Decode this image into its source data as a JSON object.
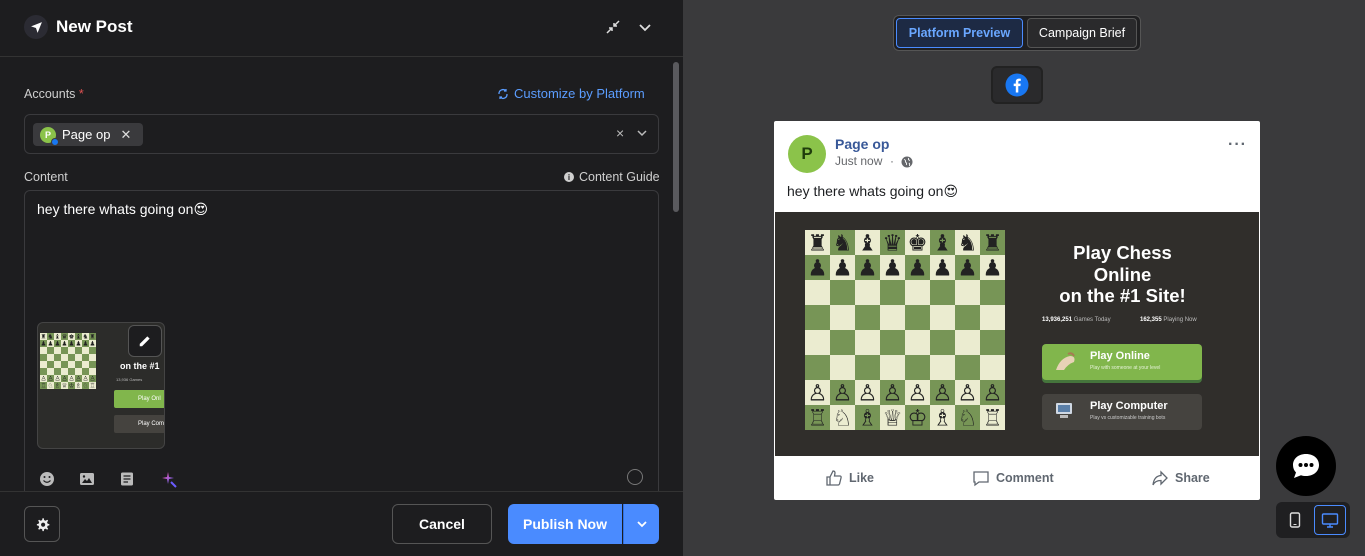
{
  "editor": {
    "title": "New Post",
    "accounts_label": "Accounts",
    "required_mark": "*",
    "customize_label": "Customize by Platform",
    "account_chip": {
      "initial": "P",
      "name": "Page op",
      "remove": "✕"
    },
    "clear_glyph": "×",
    "content_label": "Content",
    "content_guide_label": "Content Guide",
    "content_text": "hey there whats going on😍",
    "toolbar_icons": [
      "emoji-icon",
      "image-icon",
      "template-icon",
      "ai-sparkle-icon"
    ]
  },
  "footer": {
    "cancel_label": "Cancel",
    "publish_label": "Publish Now"
  },
  "preview": {
    "tabs": [
      "Platform Preview",
      "Campaign Brief"
    ],
    "active_tab": "Platform Preview",
    "platform": "facebook-icon",
    "post": {
      "avatar_initial": "P",
      "page_name": "Page op",
      "time": "Just now",
      "separator": "·",
      "more": "···",
      "text": "hey there whats going on😍",
      "image": {
        "headline_1": "Play Chess",
        "headline_2": "Online",
        "headline_3": "on the #1 Site!",
        "stat1_num": "13,936,251",
        "stat1_label": "Games Today",
        "stat2_num": "162,355",
        "stat2_label": "Playing Now",
        "btn1_title": "Play Online",
        "btn1_sub": "Play with someone at your level",
        "btn2_title": "Play Computer",
        "btn2_sub": "Play vs customizable training bots"
      },
      "actions": {
        "like": "Like",
        "comment": "Comment",
        "share": "Share"
      }
    }
  },
  "colors": {
    "accent": "#4a8bff",
    "facebook": "#1877f2",
    "chess_green": "#81b64c"
  }
}
